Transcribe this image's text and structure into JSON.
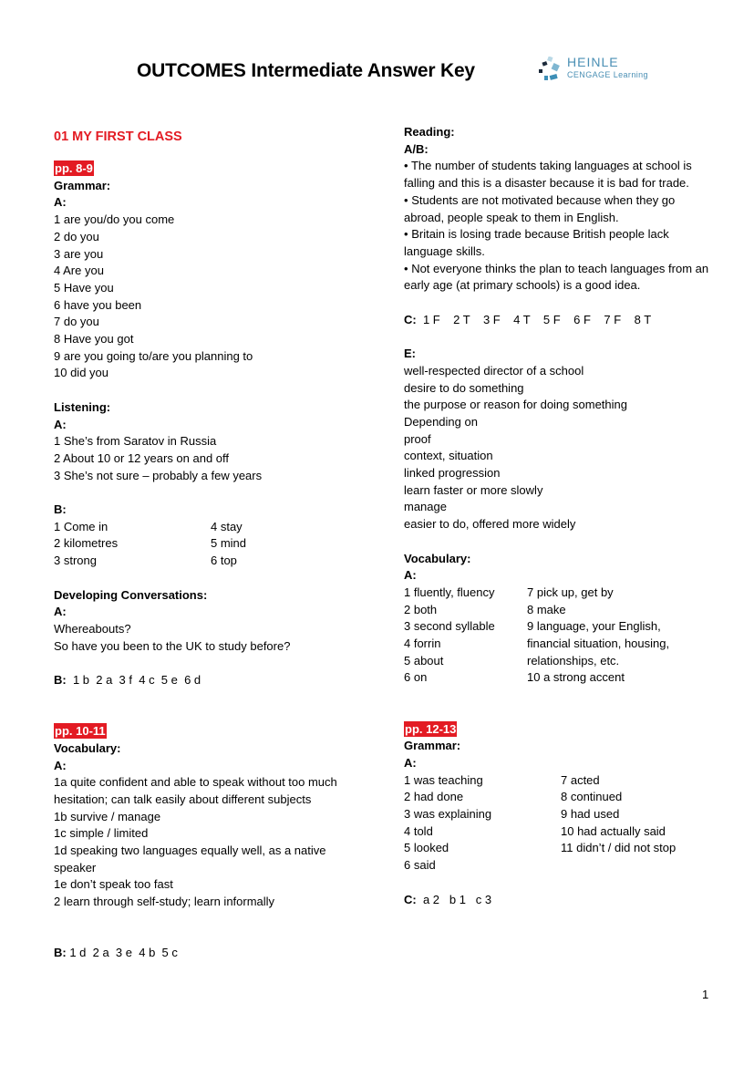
{
  "header": {
    "title": "OUTCOMES Intermediate Answer Key",
    "logo": {
      "line1": "HEINLE",
      "line2": "CENGAGE Learning",
      "icon": "heinle-logo-icon",
      "color": "#4a8fb4"
    }
  },
  "colors": {
    "accent_red": "#e31b23"
  },
  "left": {
    "unit_title": "01 MY FIRST CLASS",
    "pp89": {
      "pages": "pp. 8-9",
      "grammar": {
        "heading": "Grammar:",
        "sub": "A:",
        "items": [
          "1 are you/do you come",
          "2 do you",
          "3 are you",
          "4 Are you",
          "5 Have you",
          "6 have you been",
          "7 do you",
          "8 Have you got",
          "9 are you going to/are you planning to",
          "10 did you"
        ]
      },
      "listening": {
        "heading": "Listening:",
        "a_label": "A:",
        "a_items": [
          "1 She’s from Saratov in Russia",
          "2 About 10 or 12 years on and off",
          "3 She’s not sure – probably a few years"
        ],
        "b_label": "B:",
        "b_col1": [
          "1 Come in",
          "2 kilometres",
          "3 strong"
        ],
        "b_col2": [
          "4 stay",
          "5 mind",
          "6 top"
        ]
      },
      "conversations": {
        "heading": "Developing Conversations:",
        "a_label": "A:",
        "a_items": [
          "Whereabouts?",
          "So have you been to the UK to study before?"
        ],
        "b_label": "B:",
        "b_answer": "1 b  2 a  3 f  4 c  5 e  6 d"
      }
    },
    "pp1011": {
      "pages": "pp. 10-11",
      "vocabulary": {
        "heading": "Vocabulary:",
        "a_label": "A:",
        "a_items": [
          "1a quite confident and able to speak without too much hesitation; can talk easily about different subjects",
          "1b survive / manage",
          "1c simple / limited",
          "1d speaking two languages equally well, as a native speaker",
          "1e don’t speak too fast",
          "2 learn through self-study; learn informally"
        ],
        "b_label": "B:",
        "b_answer": "1 d  2 a  3 e  4 b  5 c"
      }
    }
  },
  "right": {
    "reading": {
      "heading": "Reading:",
      "ab_label": "A/B:",
      "bullets": [
        "The number of students taking languages at school is falling and this is a disaster because it is bad for trade.",
        "Students are not motivated because when they go abroad, people speak to them in English.",
        "Britain is losing trade because British people lack language skills.",
        "Not everyone thinks the plan to teach languages from an early age (at primary schools) is a good idea."
      ],
      "bullet_char": "•",
      "c_label": "C:",
      "c_answer": "1 F    2 T    3 F    4 T    5 F    6 F    7 F    8 T",
      "e_label": "E:",
      "e_items": [
        "well-respected director of a school",
        "desire to do something",
        "the purpose or reason for doing something",
        "Depending on",
        "proof",
        "context, situation",
        "linked progression",
        "learn faster or more slowly",
        "manage",
        "easier to do, offered more widely"
      ]
    },
    "vocabulary": {
      "heading": "Vocabulary:",
      "a_label": "A:",
      "col1": [
        "1 fluently, fluency",
        "2 both",
        "3 second syllable",
        "4 forrin",
        "5 about",
        "6 on"
      ],
      "col2": [
        "7 pick up, get by",
        "8 make",
        "9 language, your English,",
        "financial situation, housing,",
        "relationships, etc.",
        "10 a strong accent"
      ]
    },
    "pp1213": {
      "pages": "pp. 12-13",
      "grammar": {
        "heading": "Grammar:",
        "a_label": "A:",
        "col1": [
          "1 was teaching",
          "2 had done",
          "3 was explaining",
          "4 told",
          "5 looked",
          "6 said"
        ],
        "col2": [
          "7 acted",
          "8 continued",
          "9 had used",
          "10 had actually said",
          "11 didn’t / did not stop"
        ],
        "c_label": "C:",
        "c_answer": "a 2   b 1   c 3"
      }
    }
  },
  "footer": {
    "page_number": "1"
  }
}
